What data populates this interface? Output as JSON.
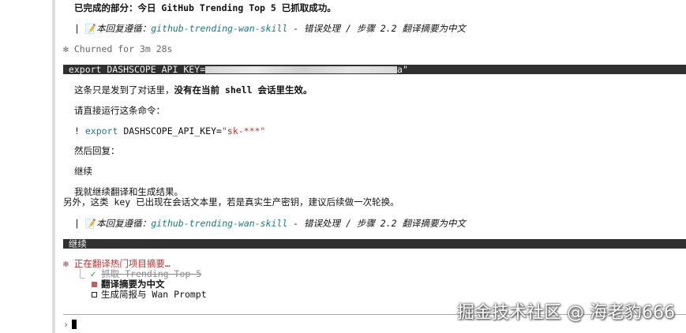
{
  "line_completed": "已完成的部分：今日 GitHub Trending Top 5 已抓取成功。",
  "reply_prefix": "本回复遵循：",
  "skill_name": "github-trending-wan-skill",
  "reply_suffix": " - 错误处理 / 步骤 2.2 翻译摘要为中文",
  "churn": {
    "star": "✻",
    "text": " Churned for 3m 28s"
  },
  "user_cmd": {
    "prefix": " export DASHSCOPE_API_KEY=",
    "suffix": "a\""
  },
  "notice": {
    "start": "这条只是发到了对话里，",
    "bold": "没有在当前 shell 会话里生效。"
  },
  "run_prompt": "请直接运行这条命令：",
  "cmd": {
    "bang": "! ",
    "kw": "export",
    "name": " DASHSCOPE_API_KEY=",
    "value": "\"sk-***\""
  },
  "then_reply": "然后回复：",
  "continue_word": "继续",
  "will_continue": "我就继续翻译和生成结果。",
  "key_warning": "另外，这类 key 已出现在会话文本里，若是真实生产密钥，建议后续做一次轮换。",
  "user_continue": " 继续",
  "status": {
    "star": "✻",
    "text": " 正在翻译热门项目摘要…"
  },
  "tasks": [
    {
      "label": "抓取 Trending Top 5",
      "state": "done"
    },
    {
      "label": "翻译摘要为中文",
      "state": "active"
    },
    {
      "label": "生成简报与 Wan Prompt",
      "state": "pending"
    }
  ],
  "prompt_symbol": "›",
  "watermark": "掘金技术社区 @ 海老豹666",
  "colors": {
    "accent": "#1b7c80",
    "status": "#c03030",
    "bar": "#303030"
  }
}
